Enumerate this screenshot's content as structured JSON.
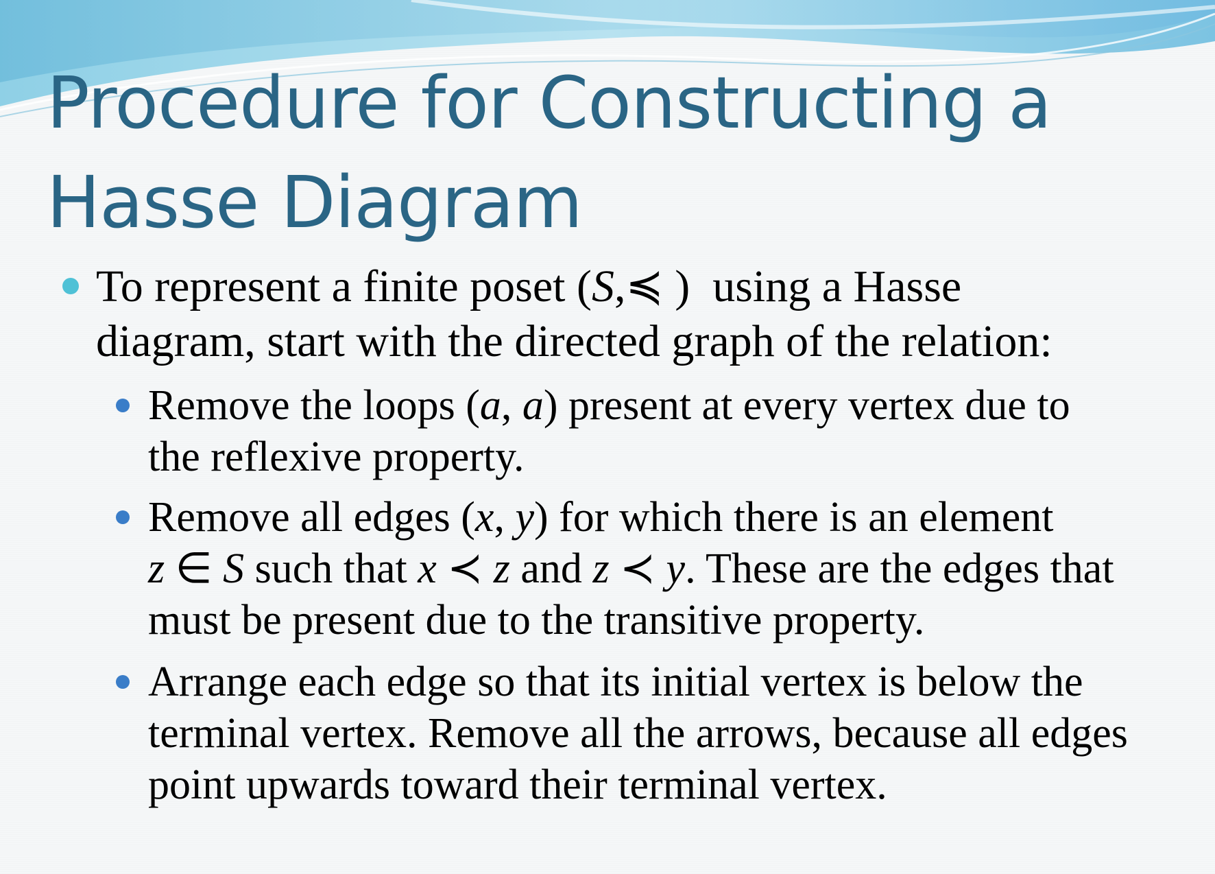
{
  "title": {
    "line1": "Procedure for Constructing a",
    "line2": "Hasse Diagram"
  },
  "intro": {
    "line1": "To represent a finite poset (S,≼ )  using a Hasse",
    "line2": "diagram, start with the directed graph of the relation:"
  },
  "steps": [
    {
      "lines": [
        "Remove the loops (a, a) present at every vertex due to",
        "the reflexive property."
      ]
    },
    {
      "lines": [
        "Remove all edges (x, y) for which there is an element",
        "z ∈ S such that x ≺ z and z ≺ y. These are the edges that",
        "must be present due to the transitive property."
      ]
    },
    {
      "lines": [
        "Arrange each edge so that its initial vertex is below the",
        "terminal vertex. Remove all the arrows, because all edges",
        "point upwards toward their terminal vertex."
      ]
    }
  ],
  "colors": {
    "title": "#2a6585",
    "bullet_level1": "#4fc1d6",
    "bullet_level2": "#3a7dc8",
    "wave_light": "#a9d8ea",
    "wave_dark": "#5fb3d6"
  }
}
